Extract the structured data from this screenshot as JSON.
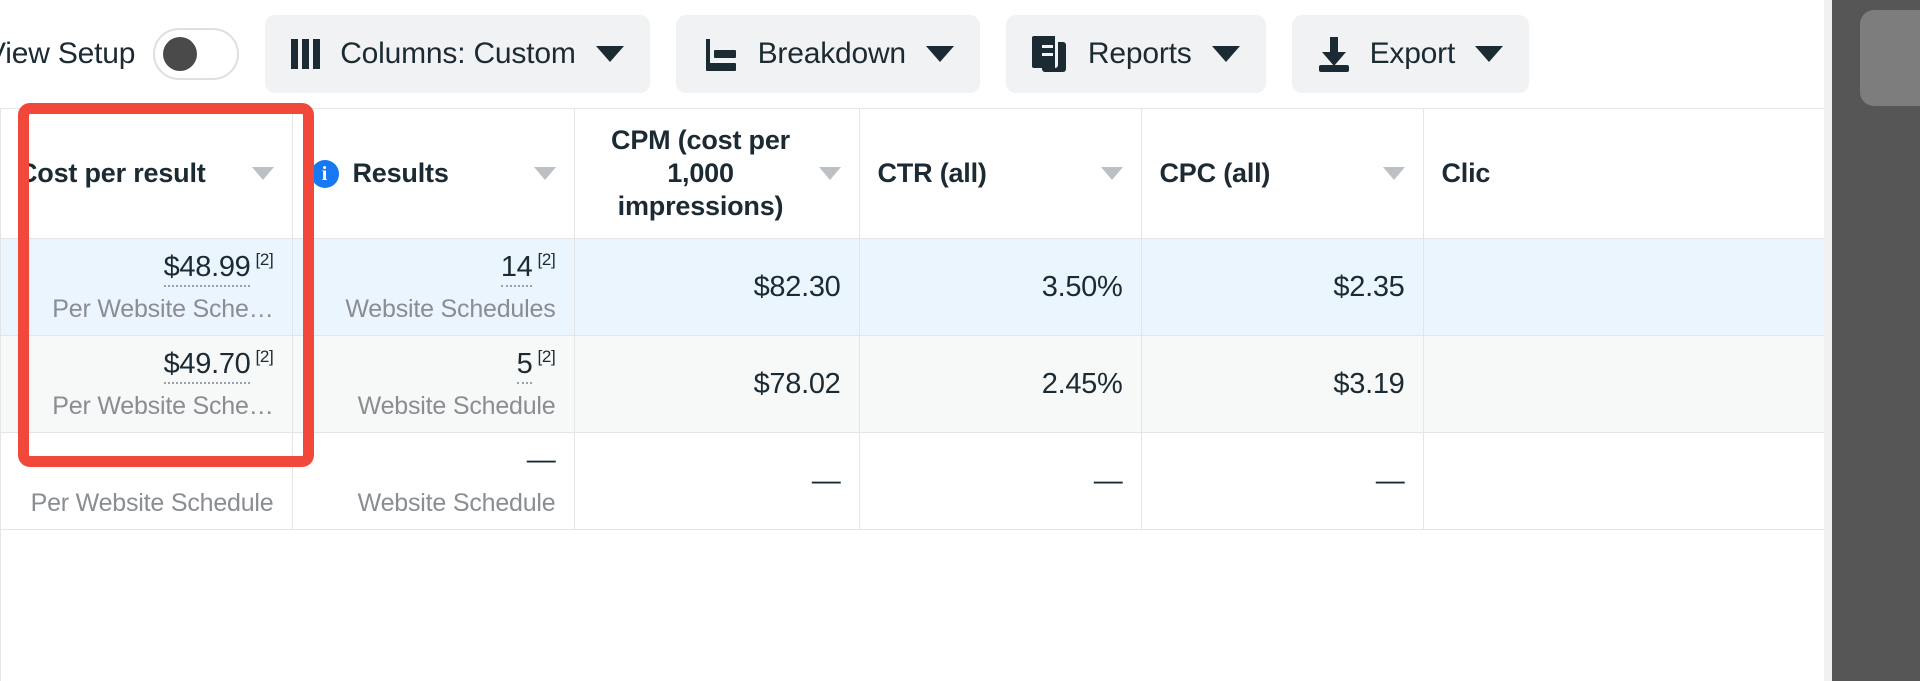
{
  "toolbar": {
    "view_setup_label": "View Setup",
    "view_setup_toggle_state": "off",
    "buttons": [
      {
        "label": "Columns: Custom",
        "icon": "columns-icon",
        "has_caret": true
      },
      {
        "label": "Breakdown",
        "icon": "breakdown-icon",
        "has_caret": true
      },
      {
        "label": "Reports",
        "icon": "reports-icon",
        "has_caret": true
      },
      {
        "label": "Export",
        "icon": "export-icon",
        "has_caret": true
      }
    ]
  },
  "os_strip": {
    "icon": "clock-icon"
  },
  "annotation": {
    "color": "#f2483c",
    "target_column": "Cost per result"
  },
  "table": {
    "columns": [
      {
        "label": "Cost per result",
        "has_info": false,
        "has_sort": true
      },
      {
        "label": "Results",
        "has_info": true,
        "has_sort": true
      },
      {
        "label": "CPM (cost per 1,000 impressions)",
        "has_info": false,
        "has_sort": true
      },
      {
        "label": "CTR (all)",
        "has_info": false,
        "has_sort": true
      },
      {
        "label": "CPC (all)",
        "has_info": false,
        "has_sort": true
      },
      {
        "label": "Clic",
        "has_info": false,
        "has_sort": false
      }
    ],
    "rows": [
      {
        "state": "selected",
        "cost_per_result": "$48.99",
        "cost_per_result_sup": "[2]",
        "cost_per_result_sub": "Per Website Sche…",
        "results": "14",
        "results_sup": "[2]",
        "results_sub": "Website Schedules",
        "cpm": "$82.30",
        "ctr": "3.50%",
        "cpc": "$2.35",
        "clicks": ""
      },
      {
        "state": "alt",
        "cost_per_result": "$49.70",
        "cost_per_result_sup": "[2]",
        "cost_per_result_sub": "Per Website Sche…",
        "results": "5",
        "results_sup": "[2]",
        "results_sub": "Website Schedule",
        "cpm": "$78.02",
        "ctr": "2.45%",
        "cpc": "$3.19",
        "clicks": ""
      },
      {
        "state": "plain",
        "cost_per_result": "—",
        "cost_per_result_sup": "",
        "cost_per_result_sub": "Per Website Schedule",
        "results": "—",
        "results_sup": "",
        "results_sub": "Website Schedule",
        "cpm": "—",
        "ctr": "—",
        "cpc": "—",
        "clicks": ""
      }
    ]
  }
}
